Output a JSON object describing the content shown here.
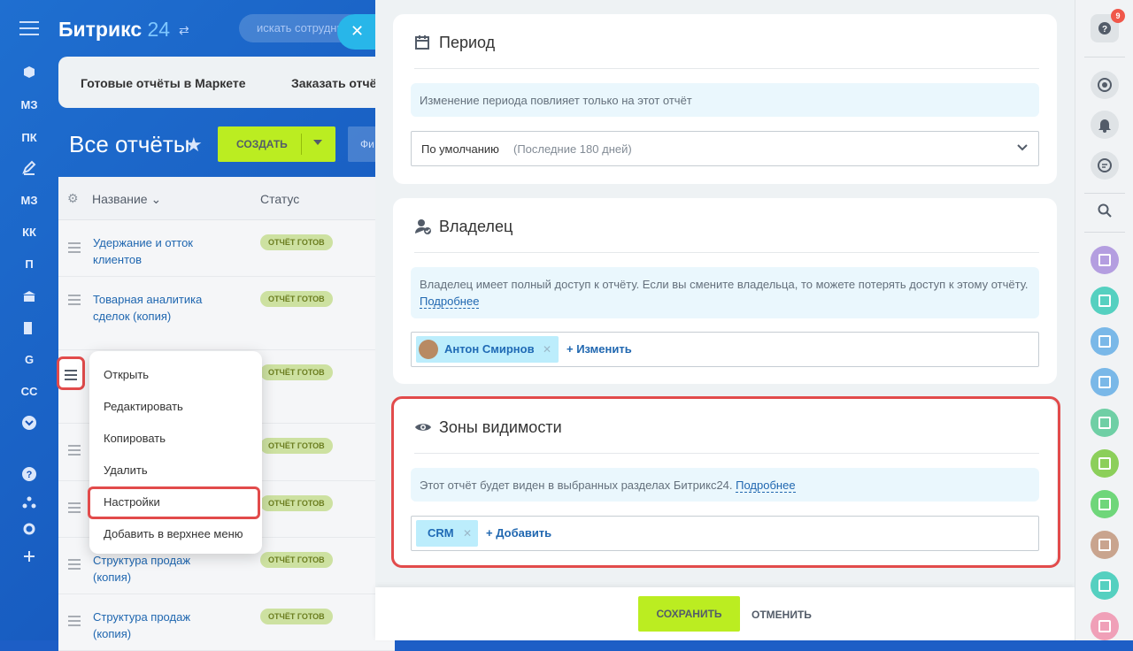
{
  "app": {
    "brand_name": "Битрикс",
    "brand_number": "24",
    "search_placeholder": "искать сотрудника"
  },
  "left_nav": {
    "items": [
      "МЗ",
      "ПК",
      "МЗ",
      "КК",
      "П",
      "G",
      "СС"
    ]
  },
  "market_tabs": [
    "Готовые отчёты в Маркете",
    "Заказать отчёт"
  ],
  "page": {
    "title": "Все отчёты",
    "create_label": "СОЗДАТЬ",
    "filter_label": "Фи"
  },
  "table": {
    "col_name": "Название",
    "col_status": "Статус",
    "rows": [
      {
        "name": "Удержание и отток клиентов",
        "status": "ОТЧЁТ ГОТОВ"
      },
      {
        "name": "Товарная аналитика сделок (копия)",
        "status": "ОТЧЁТ ГОТОВ"
      },
      {
        "name": "",
        "status": "ОТЧЁТ ГОТОВ"
      },
      {
        "name": "",
        "status": "ОТЧЁТ ГОТОВ"
      },
      {
        "name": "",
        "status": "ОТЧЁТ ГОТОВ"
      },
      {
        "name": "Структура продаж (копия)",
        "status": "ОТЧЁТ ГОТОВ"
      },
      {
        "name": "Структура продаж (копия)",
        "status": "ОТЧЁТ ГОТОВ"
      }
    ]
  },
  "context_menu": {
    "items": [
      "Открыть",
      "Редактировать",
      "Копировать",
      "Удалить",
      "Настройки",
      "Добавить в верхнее меню"
    ]
  },
  "settings": {
    "period": {
      "title": "Период",
      "note": "Изменение периода повлияет только на этот отчёт",
      "select_value": "По умолчанию",
      "select_hint": "(Последние 180 дней)"
    },
    "owner": {
      "title": "Владелец",
      "note": "Владелец имеет полный доступ к отчёту. Если вы смените владельца, то можете потерять доступ к этому отчёту.",
      "note_link": "Подробнее",
      "owner_name": "Антон Смирнов",
      "change_label": "+ Изменить"
    },
    "visibility": {
      "title": "Зоны видимости",
      "note": "Этот отчёт будет виден в выбранных разделах Битрикс24.",
      "note_link": "Подробнее",
      "tag": "CRM",
      "add_label": "+ Добавить"
    }
  },
  "footer": {
    "save_label": "СОХРАНИТЬ",
    "cancel_label": "ОТМЕНИТЬ"
  },
  "right_bar": {
    "help_counter": "9",
    "task_avatar_colors": [
      "#b49ee0",
      "#55d0c0",
      "#7ab8e8",
      "#7ab8e8",
      "#6fcfa5",
      "#8ccf5a",
      "#6fd67a",
      "#c9a48e",
      "#55d0c0",
      "#f0a0b8"
    ]
  },
  "colors": {
    "accent_green": "#bbed21",
    "highlight_red": "#e24b4b",
    "link_blue": "#2067b0"
  }
}
